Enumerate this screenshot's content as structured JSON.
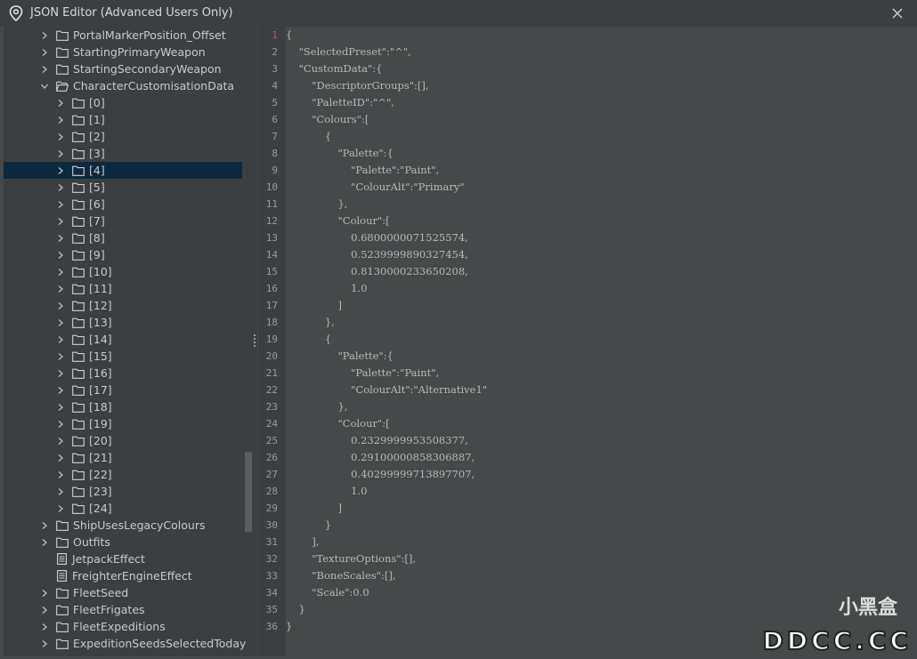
{
  "window": {
    "title": "JSON Editor (Advanced Users Only)",
    "icon": "location-pin-icon",
    "close_icon": "close-icon"
  },
  "tree": {
    "selected_index": 8,
    "items": [
      {
        "label": "PortalMarkerPosition_Offset",
        "depth": 1,
        "type": "folder",
        "expandable": true,
        "expanded": false
      },
      {
        "label": "StartingPrimaryWeapon",
        "depth": 1,
        "type": "folder",
        "expandable": true,
        "expanded": false
      },
      {
        "label": "StartingSecondaryWeapon",
        "depth": 1,
        "type": "folder",
        "expandable": true,
        "expanded": false
      },
      {
        "label": "CharacterCustomisationData",
        "depth": 1,
        "type": "folder",
        "expandable": true,
        "expanded": true
      },
      {
        "label": "[0]",
        "depth": 2,
        "type": "folder",
        "expandable": true,
        "expanded": false
      },
      {
        "label": "[1]",
        "depth": 2,
        "type": "folder",
        "expandable": true,
        "expanded": false
      },
      {
        "label": "[2]",
        "depth": 2,
        "type": "folder",
        "expandable": true,
        "expanded": false
      },
      {
        "label": "[3]",
        "depth": 2,
        "type": "folder",
        "expandable": true,
        "expanded": false
      },
      {
        "label": "[4]",
        "depth": 2,
        "type": "folder",
        "expandable": true,
        "expanded": false
      },
      {
        "label": "[5]",
        "depth": 2,
        "type": "folder",
        "expandable": true,
        "expanded": false
      },
      {
        "label": "[6]",
        "depth": 2,
        "type": "folder",
        "expandable": true,
        "expanded": false
      },
      {
        "label": "[7]",
        "depth": 2,
        "type": "folder",
        "expandable": true,
        "expanded": false
      },
      {
        "label": "[8]",
        "depth": 2,
        "type": "folder",
        "expandable": true,
        "expanded": false
      },
      {
        "label": "[9]",
        "depth": 2,
        "type": "folder",
        "expandable": true,
        "expanded": false
      },
      {
        "label": "[10]",
        "depth": 2,
        "type": "folder",
        "expandable": true,
        "expanded": false
      },
      {
        "label": "[11]",
        "depth": 2,
        "type": "folder",
        "expandable": true,
        "expanded": false
      },
      {
        "label": "[12]",
        "depth": 2,
        "type": "folder",
        "expandable": true,
        "expanded": false
      },
      {
        "label": "[13]",
        "depth": 2,
        "type": "folder",
        "expandable": true,
        "expanded": false
      },
      {
        "label": "[14]",
        "depth": 2,
        "type": "folder",
        "expandable": true,
        "expanded": false
      },
      {
        "label": "[15]",
        "depth": 2,
        "type": "folder",
        "expandable": true,
        "expanded": false
      },
      {
        "label": "[16]",
        "depth": 2,
        "type": "folder",
        "expandable": true,
        "expanded": false
      },
      {
        "label": "[17]",
        "depth": 2,
        "type": "folder",
        "expandable": true,
        "expanded": false
      },
      {
        "label": "[18]",
        "depth": 2,
        "type": "folder",
        "expandable": true,
        "expanded": false
      },
      {
        "label": "[19]",
        "depth": 2,
        "type": "folder",
        "expandable": true,
        "expanded": false
      },
      {
        "label": "[20]",
        "depth": 2,
        "type": "folder",
        "expandable": true,
        "expanded": false
      },
      {
        "label": "[21]",
        "depth": 2,
        "type": "folder",
        "expandable": true,
        "expanded": false
      },
      {
        "label": "[22]",
        "depth": 2,
        "type": "folder",
        "expandable": true,
        "expanded": false
      },
      {
        "label": "[23]",
        "depth": 2,
        "type": "folder",
        "expandable": true,
        "expanded": false
      },
      {
        "label": "[24]",
        "depth": 2,
        "type": "folder",
        "expandable": true,
        "expanded": false
      },
      {
        "label": "ShipUsesLegacyColours",
        "depth": 1,
        "type": "folder",
        "expandable": true,
        "expanded": false
      },
      {
        "label": "Outfits",
        "depth": 1,
        "type": "folder",
        "expandable": true,
        "expanded": false
      },
      {
        "label": "JetpackEffect",
        "depth": 1,
        "type": "file",
        "expandable": false,
        "expanded": false
      },
      {
        "label": "FreighterEngineEffect",
        "depth": 1,
        "type": "file",
        "expandable": false,
        "expanded": false
      },
      {
        "label": "FleetSeed",
        "depth": 1,
        "type": "folder",
        "expandable": true,
        "expanded": false
      },
      {
        "label": "FleetFrigates",
        "depth": 1,
        "type": "folder",
        "expandable": true,
        "expanded": false
      },
      {
        "label": "FleetExpeditions",
        "depth": 1,
        "type": "folder",
        "expandable": true,
        "expanded": false
      },
      {
        "label": "ExpeditionSeedsSelectedToday",
        "depth": 1,
        "type": "folder",
        "expandable": true,
        "expanded": false
      }
    ]
  },
  "editor": {
    "error_line": 1,
    "lines": [
      "{",
      "    \"SelectedPreset\":\"^\",",
      "    \"CustomData\":{",
      "        \"DescriptorGroups\":[],",
      "        \"PaletteID\":\"^\",",
      "        \"Colours\":[",
      "            {",
      "                \"Palette\":{",
      "                    \"Palette\":\"Paint\",",
      "                    \"ColourAlt\":\"Primary\"",
      "                },",
      "                \"Colour\":[",
      "                    0.6800000071525574,",
      "                    0.5239999890327454,",
      "                    0.8130000233650208,",
      "                    1.0",
      "                ]",
      "            },",
      "            {",
      "                \"Palette\":{",
      "                    \"Palette\":\"Paint\",",
      "                    \"ColourAlt\":\"Alternative1\"",
      "                },",
      "                \"Colour\":[",
      "                    0.2329999953508377,",
      "                    0.29100000858306887,",
      "                    0.40299999713897707,",
      "                    1.0",
      "                ]",
      "            }",
      "        ],",
      "        \"TextureOptions\":[],",
      "        \"BoneScales\":[],",
      "        \"Scale\":0.0",
      "    }",
      "}"
    ]
  },
  "watermark": {
    "text": "DDCC.CC",
    "cn_text": "小黑盒"
  },
  "colors": {
    "background": "#45494a",
    "panel": "#3c3f41",
    "selection": "#0d293e",
    "error_line_number": "#c75450"
  }
}
